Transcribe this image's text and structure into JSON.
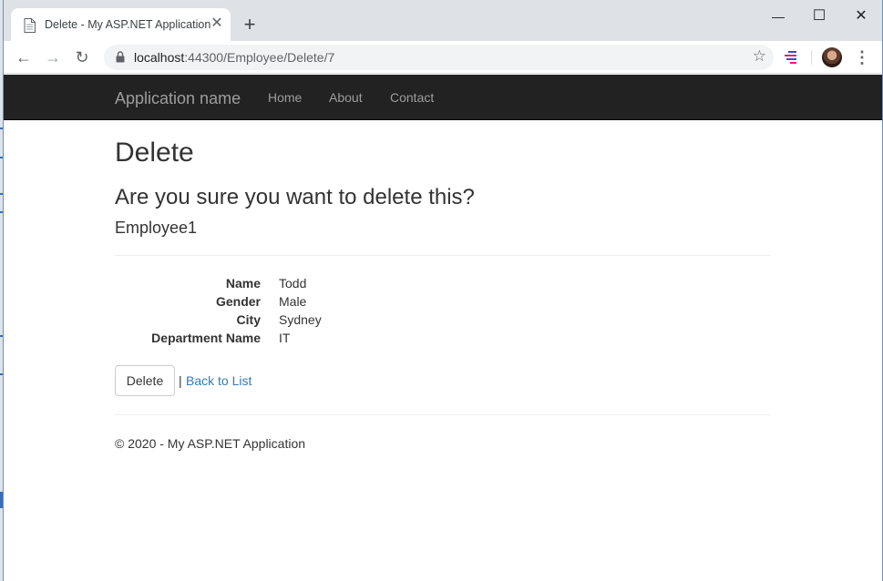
{
  "browser": {
    "tab_title": "Delete - My ASP.NET Application",
    "tab_close": "✕",
    "new_tab": "+",
    "window_controls": {
      "minimize": "—",
      "maximize": "☐",
      "close": "✕"
    },
    "nav": {
      "back": "←",
      "forward": "→",
      "reload": "↻"
    },
    "url_host": "localhost",
    "url_path": ":44300/Employee/Delete/7",
    "bookmark": "☆",
    "menu": "⋮"
  },
  "site": {
    "brand": "Application name",
    "nav_links": [
      "Home",
      "About",
      "Contact"
    ]
  },
  "main": {
    "heading": "Delete",
    "question": "Are you sure you want to delete this?",
    "entity": "Employee1",
    "fields": [
      {
        "label": "Name",
        "value": "Todd"
      },
      {
        "label": "Gender",
        "value": "Male"
      },
      {
        "label": "City",
        "value": "Sydney"
      },
      {
        "label": "Department Name",
        "value": "IT"
      }
    ],
    "delete_button": "Delete",
    "separator": "|",
    "back_link": "Back to List"
  },
  "footer": {
    "text": "© 2020 - My ASP.NET Application"
  },
  "colors": {
    "navbar": "#222222",
    "nav_text": "#9d9d9d",
    "link": "#337ab7"
  }
}
